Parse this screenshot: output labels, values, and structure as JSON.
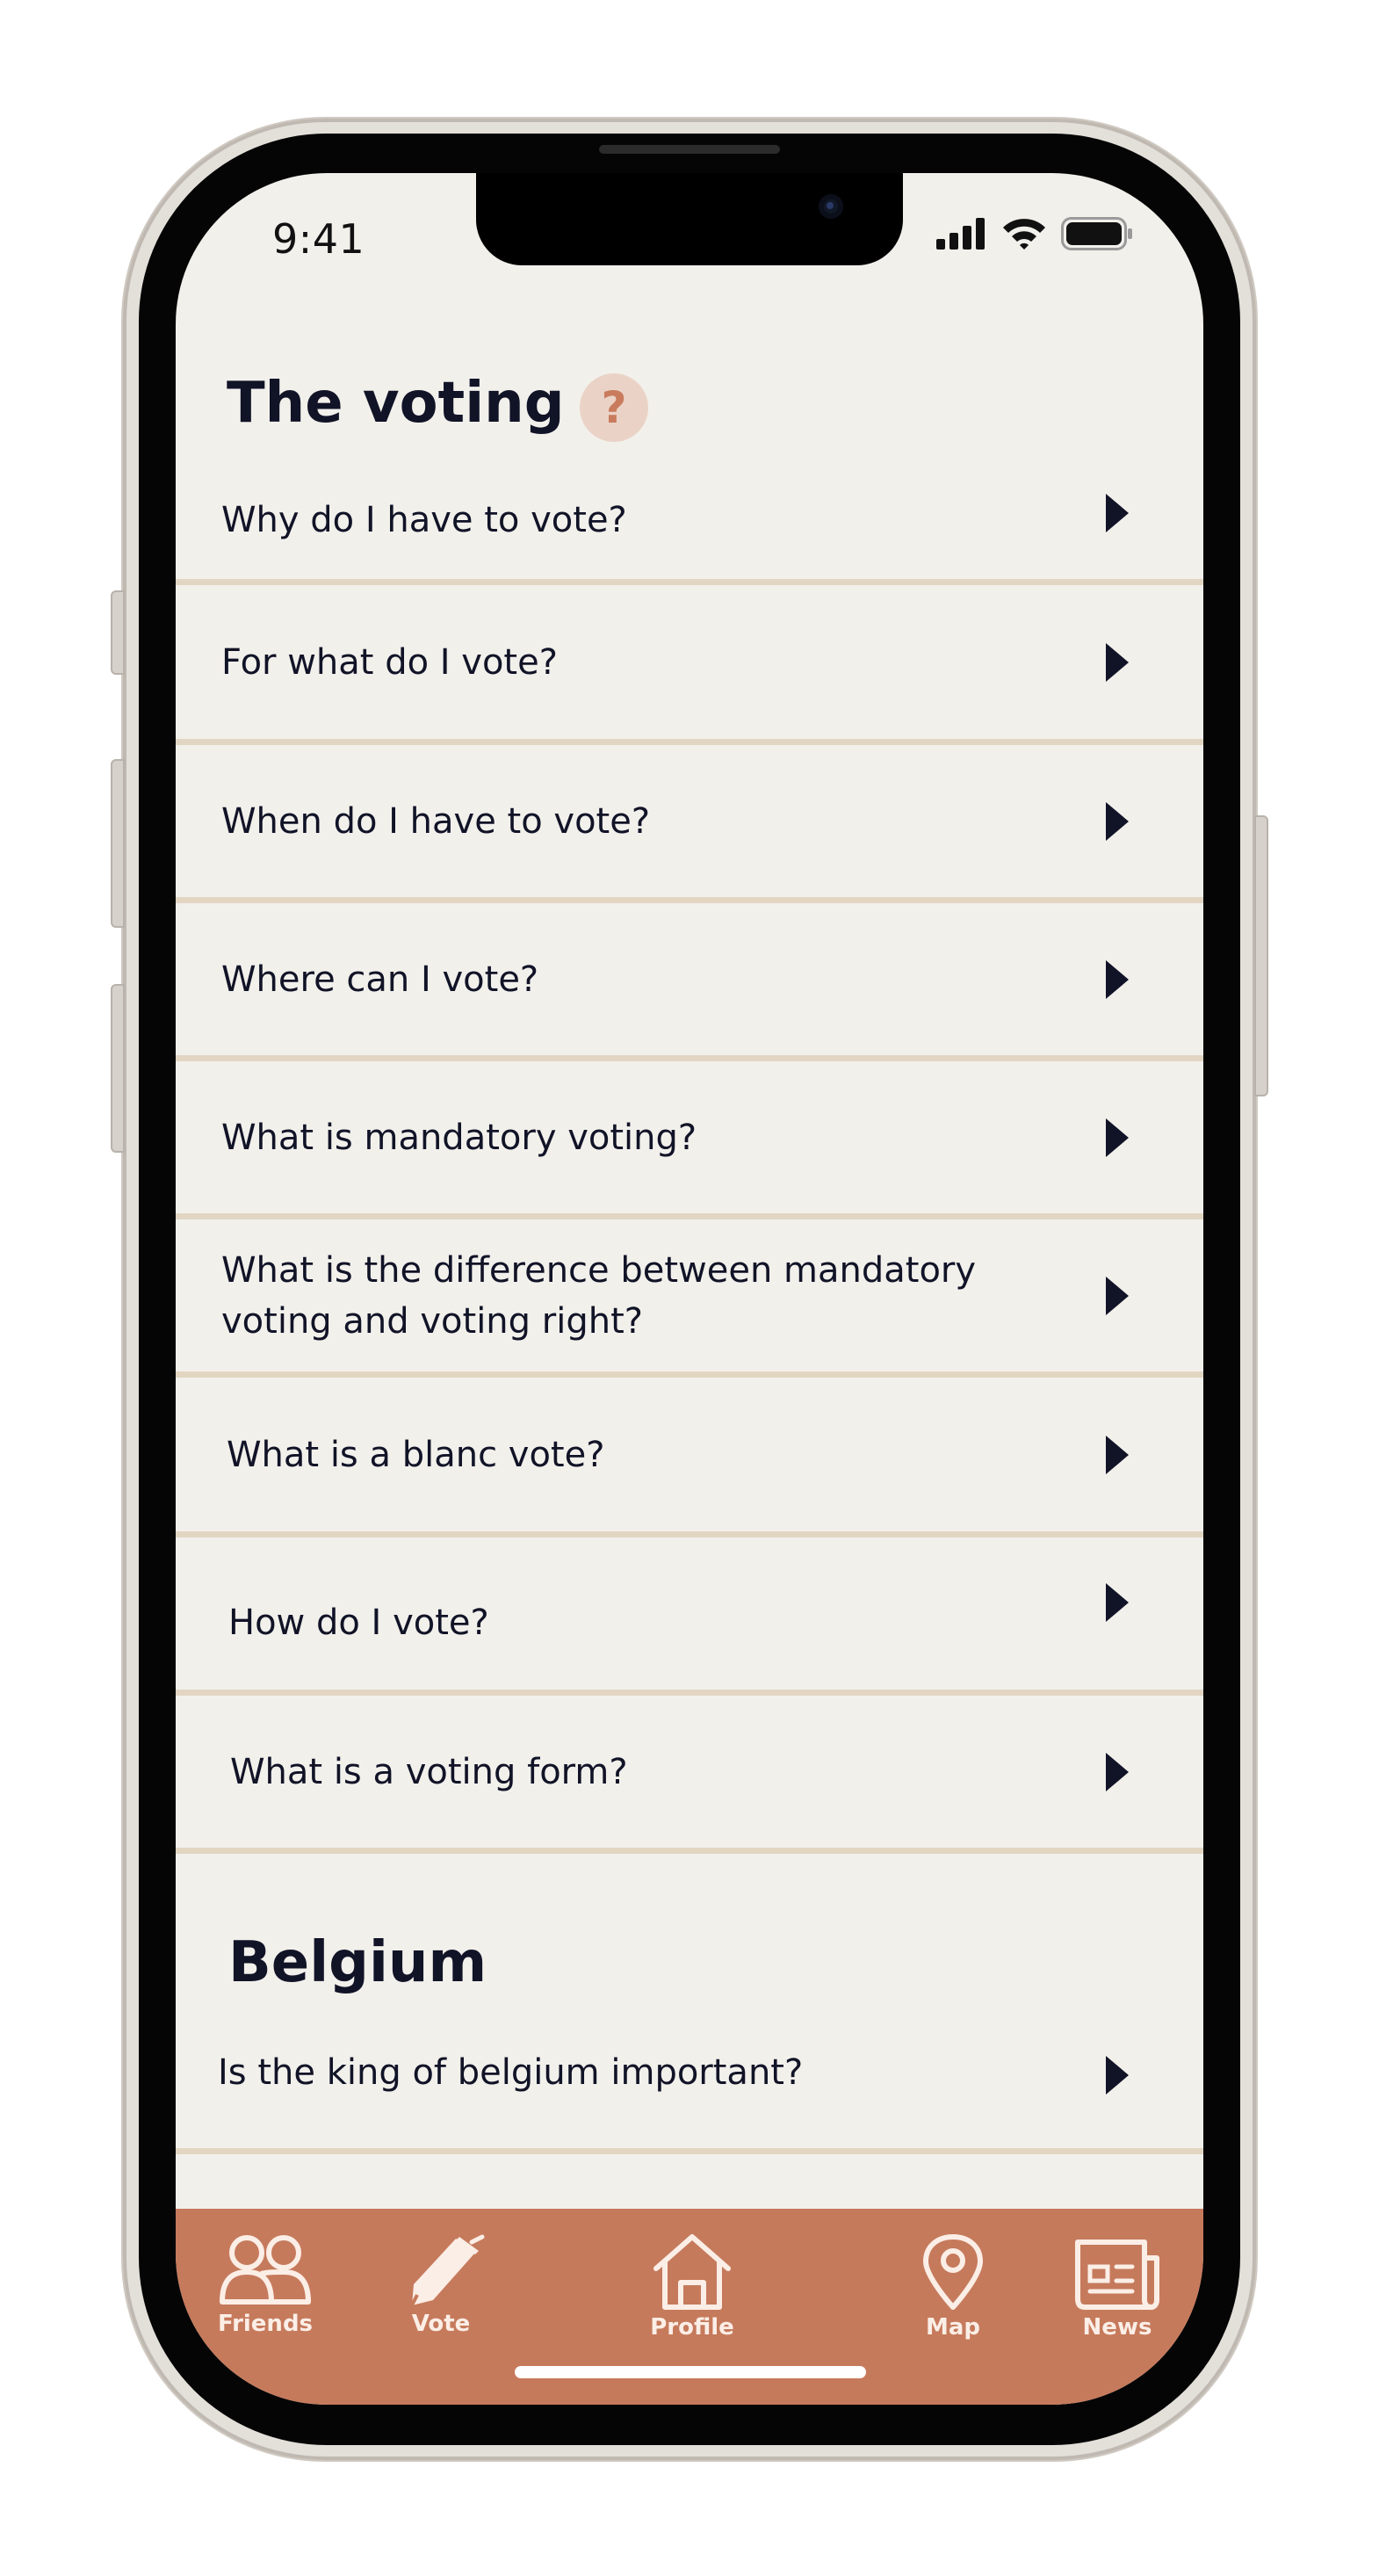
{
  "status_bar": {
    "time": "9:41"
  },
  "voting_section": {
    "title": "The voting",
    "help_icon": "?",
    "items": [
      {
        "label": "Why do I have to vote?"
      },
      {
        "label": "For what do I vote?"
      },
      {
        "label": "When do I have to vote?"
      },
      {
        "label": "Where can I vote?"
      },
      {
        "label": "What is mandatory voting?"
      },
      {
        "label": "What is the difference between mandatory voting and voting right?"
      },
      {
        "label": "What is a blanc vote?"
      },
      {
        "label": "How do I vote?"
      },
      {
        "label": "What is a voting form?"
      }
    ]
  },
  "belgium_section": {
    "title": "Belgium",
    "items": [
      {
        "label": "Is the king of belgium important?"
      }
    ]
  },
  "tab_bar": {
    "tabs": [
      {
        "label": "Friends",
        "icon": "friends-icon"
      },
      {
        "label": "Vote",
        "icon": "pen-icon"
      },
      {
        "label": "Profile",
        "icon": "home-icon"
      },
      {
        "label": "Map",
        "icon": "map-pin-icon"
      },
      {
        "label": "News",
        "icon": "newspaper-icon"
      }
    ]
  },
  "colors": {
    "background": "#f2f0eb",
    "tab_bar": "#c67a5c",
    "divider": "#e2d6c3",
    "text": "#111327",
    "help_badge": "#ead3c6"
  }
}
